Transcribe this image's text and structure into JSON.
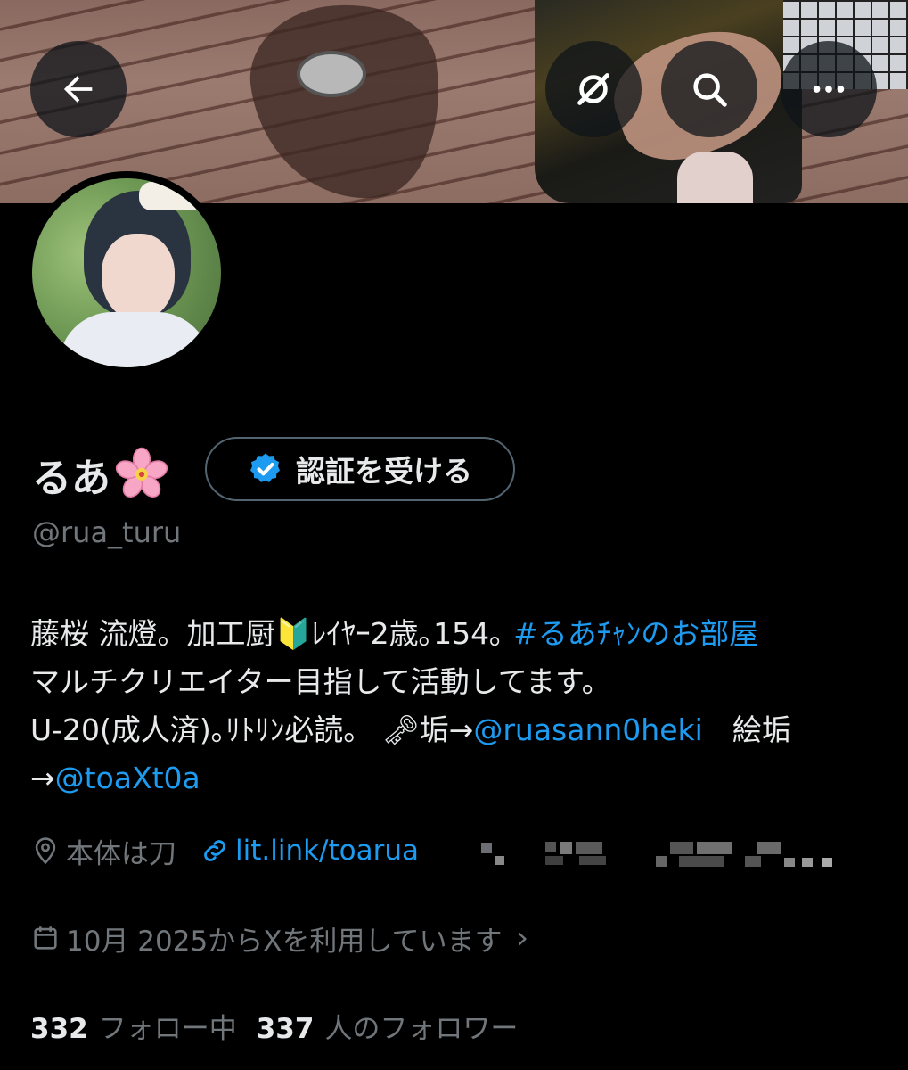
{
  "header": {
    "back_icon": "arrow-left-icon",
    "grok_icon": "grok-slash-icon",
    "search_icon": "search-icon",
    "more_icon": "more-dots-icon"
  },
  "profile": {
    "display_name": "るあ",
    "name_emoji": "cherry-blossom",
    "verify_button_label": "認証を受ける",
    "handle": "@rua_turu"
  },
  "bio": {
    "line1_text": "藤桜 流燈。加工厨🔰ﾚｲﾔｰ2歳｡154｡ ",
    "line1_hashtag": "#るあﾁｬﾝのお部屋",
    "line2_text": "マルチクリエイター目指して活動してます。",
    "line3_text": "U-20(成人済)｡ﾘﾄﾘﾝ必読。 🗝垢→",
    "line3_mention": "@ruasann0heki",
    "line3_tail": "　絵垢",
    "line4_prefix": "→",
    "line4_mention": "@toaXt0a"
  },
  "meta": {
    "location": "本体は刀",
    "url": "lit.link/toarua",
    "joined": "10月 2025からXを利用しています",
    "joined_chevron": "›"
  },
  "stats": {
    "following_count": "332",
    "following_label": "フォロー中",
    "followers_count": "337",
    "followers_label": "人のフォロワー"
  },
  "colors": {
    "background": "#000000",
    "text_primary": "#e7e9ea",
    "text_secondary": "#71767b",
    "link": "#1d9bf0",
    "button_border": "#536471"
  }
}
